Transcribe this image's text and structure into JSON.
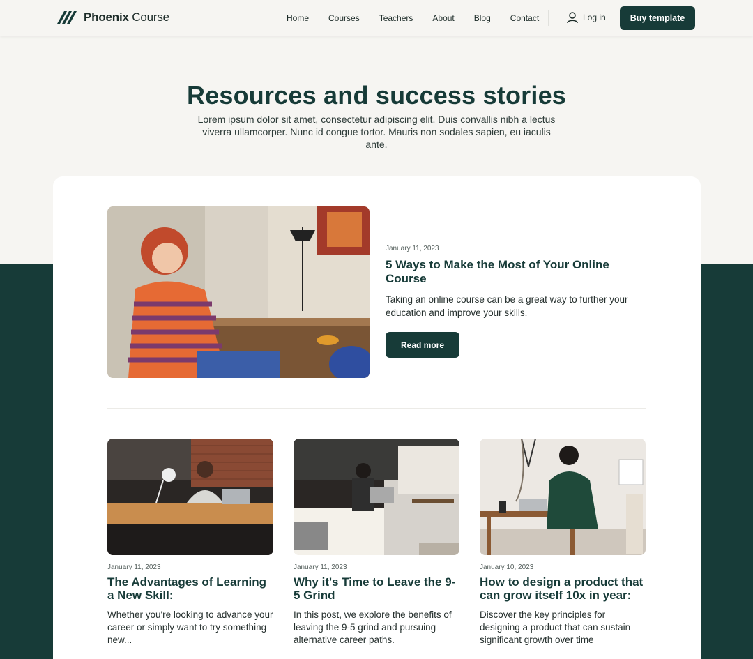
{
  "brand": {
    "name_bold": "Phoenix",
    "name_light": "Course",
    "logo_icon": "slash-logo-icon",
    "accent_color": "#173b38",
    "background_color": "#f6f5f2"
  },
  "nav": {
    "items": [
      "Home",
      "Courses",
      "Teachers",
      "About",
      "Blog",
      "Contact"
    ],
    "login_label": "Log in",
    "login_icon": "user-icon",
    "buy_label": "Buy template"
  },
  "hero": {
    "title": "Resources and success stories",
    "subtitle": "Lorem ipsum dolor sit amet, consectetur adipiscing elit. Duis convallis nibh a lectus viverra ullamcorper. Nunc id congue tortor. Mauris non sodales sapien, eu iaculis ante."
  },
  "featured": {
    "date": "January 11, 2023",
    "title": "5 Ways to Make the Most of Your Online Course",
    "description": "Taking an online course can be a great way to further your education and improve your skills.",
    "button_label": "Read more"
  },
  "posts": [
    {
      "date": "January 11, 2023",
      "title": "The Advantages of Learning a New Skill:",
      "description": "Whether you're looking to advance your career or simply want to try something new..."
    },
    {
      "date": "January 11, 2023",
      "title": "Why it's Time to Leave the 9-5 Grind",
      "description": "In this post, we explore the benefits of leaving the 9-5 grind and pursuing alternative career paths."
    },
    {
      "date": "January 10, 2023",
      "title": "How to design a product that can grow itself 10x in year:",
      "description": "Discover the key principles for designing a product that can sustain significant growth over time"
    }
  ]
}
